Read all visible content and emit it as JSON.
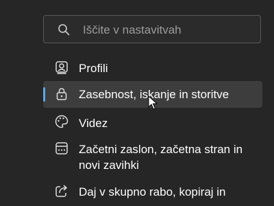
{
  "search": {
    "placeholder": "Iščite v nastavitvah",
    "icon": "search-icon"
  },
  "nav": {
    "items": [
      {
        "label": "Profili",
        "icon": "profile-icon",
        "active": false
      },
      {
        "label": "Zasebnost, iskanje in storitve",
        "icon": "lock-icon",
        "active": true
      },
      {
        "label": "Videz",
        "icon": "palette-icon",
        "active": false
      },
      {
        "label": "Začetni zaslon, začetna stran in novi zavihki",
        "icon": "home-tab-icon",
        "active": false
      },
      {
        "label": "Daj v skupno rabo, kopiraj in",
        "icon": "share-icon",
        "active": false
      }
    ]
  },
  "colors": {
    "background": "#262626",
    "active_background": "#3d3d3d",
    "accent": "#5ba7e6",
    "text": "#ffffff",
    "placeholder": "#9c9c9c"
  }
}
